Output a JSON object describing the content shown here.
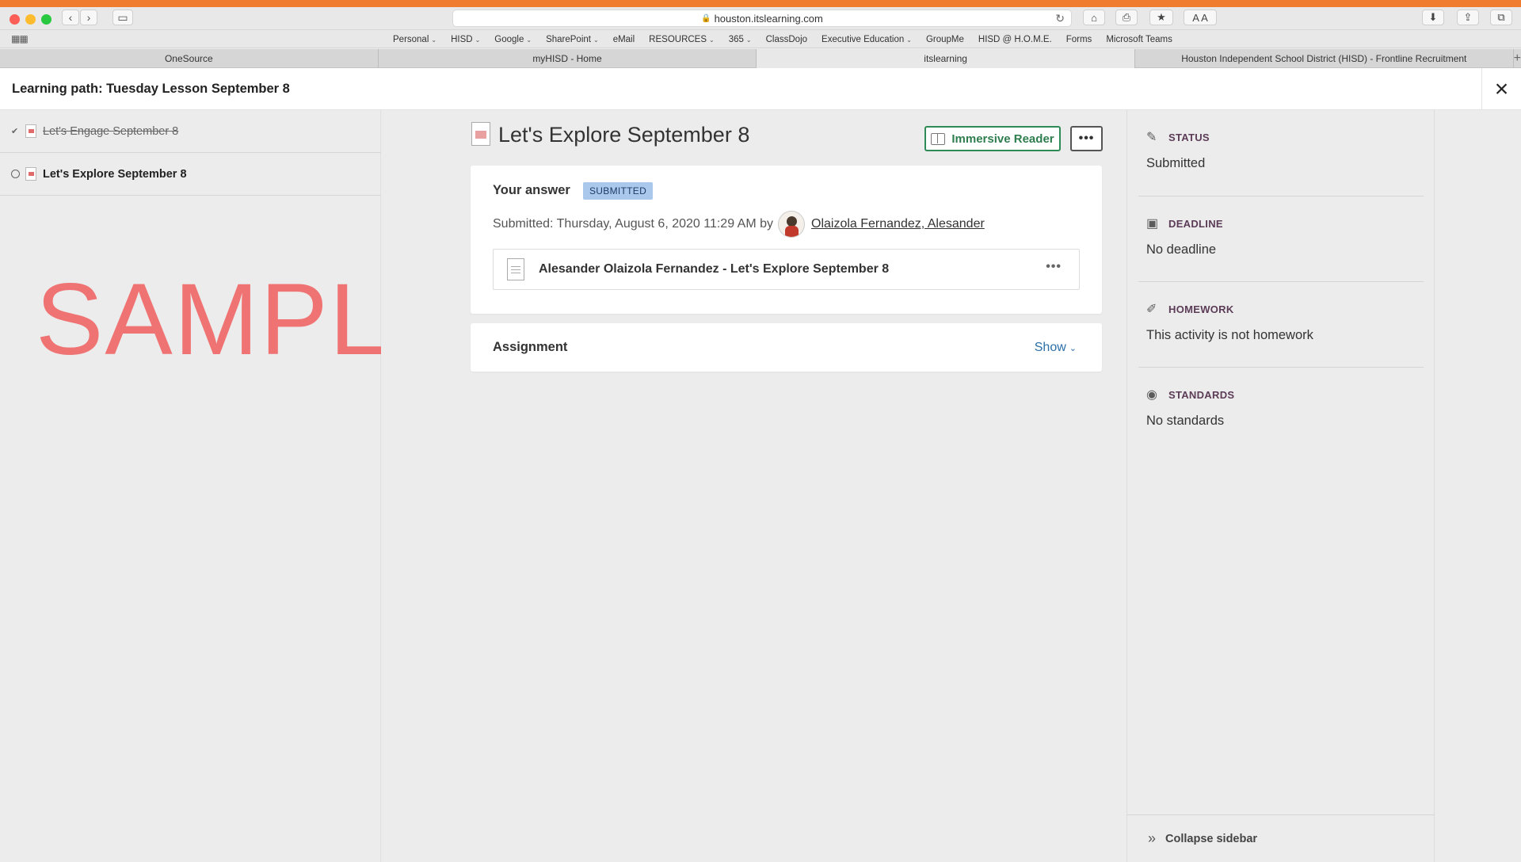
{
  "browser": {
    "url": "houston.itslearning.com",
    "bookmarks": [
      {
        "label": "Personal",
        "dropdown": true
      },
      {
        "label": "HISD",
        "dropdown": true
      },
      {
        "label": "Google",
        "dropdown": true
      },
      {
        "label": "SharePoint",
        "dropdown": true
      },
      {
        "label": "eMail",
        "dropdown": false
      },
      {
        "label": "RESOURCES",
        "dropdown": true
      },
      {
        "label": "365",
        "dropdown": true
      },
      {
        "label": "ClassDojo",
        "dropdown": false
      },
      {
        "label": "Executive Education",
        "dropdown": true
      },
      {
        "label": "GroupMe",
        "dropdown": false
      },
      {
        "label": "HISD @ H.O.M.E.",
        "dropdown": false
      },
      {
        "label": "Forms",
        "dropdown": false
      },
      {
        "label": "Microsoft Teams",
        "dropdown": false
      }
    ],
    "tabs": [
      {
        "label": "OneSource",
        "active": false
      },
      {
        "label": "myHISD - Home",
        "active": false
      },
      {
        "label": "itslearning",
        "active": true
      },
      {
        "label": "Houston Independent School District (HISD) - Frontline Recruitment",
        "active": false
      }
    ],
    "colors": {
      "accent_strip": "#f07d2f"
    }
  },
  "header": {
    "title": "Learning path: Tuesday Lesson September 8",
    "close_icon": "×"
  },
  "learning_path": {
    "items": [
      {
        "label": "Let's Engage September 8",
        "state": "completed"
      },
      {
        "label": "Let's Explore September 8",
        "state": "current"
      }
    ]
  },
  "watermark": "SAMPLE",
  "main": {
    "title": "Let's Explore September 8",
    "immersive_reader_label": "Immersive Reader",
    "more_label": "•••",
    "answer": {
      "label": "Your answer",
      "badge": "SUBMITTED",
      "submitted_text": "Submitted: Thursday, August 6, 2020 11:29 AM by",
      "user_name": "Olaizola Fernandez, Alesander",
      "file_name": "Alesander Olaizola Fernandez - Let's Explore September 8",
      "file_more": "•••"
    },
    "assignment": {
      "label": "Assignment",
      "show_label": "Show"
    }
  },
  "sidebar": {
    "sections": [
      {
        "title": "STATUS",
        "value": "Submitted",
        "icon": "pencil-icon"
      },
      {
        "title": "DEADLINE",
        "value": "No deadline",
        "icon": "calendar-icon"
      },
      {
        "title": "HOMEWORK",
        "value": "This activity is not homework",
        "icon": "homework-icon"
      },
      {
        "title": "STANDARDS",
        "value": "No standards",
        "icon": "target-icon"
      }
    ],
    "collapse_label": "Collapse sidebar"
  }
}
